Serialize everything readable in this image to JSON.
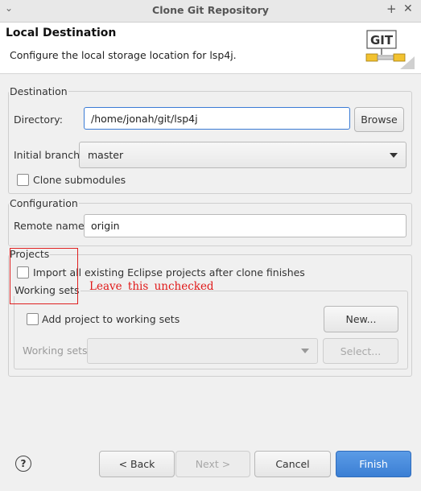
{
  "window": {
    "title": "Clone Git Repository"
  },
  "header": {
    "title": "Local Destination",
    "description": "Configure the local storage location for lsp4j.",
    "logo_text": "GIT"
  },
  "destination": {
    "group_label": "Destination",
    "directory_label": "Directory:",
    "directory_value": "/home/jonah/git/lsp4j",
    "browse_label": "Browse",
    "branch_label": "Initial branch:",
    "branch_value": "master",
    "clone_submodules_label": "Clone submodules",
    "clone_submodules_checked": false
  },
  "configuration": {
    "group_label": "Configuration",
    "remote_name_label": "Remote name:",
    "remote_name_value": "origin"
  },
  "projects": {
    "group_label": "Projects",
    "import_label": "Import all existing Eclipse projects after clone finishes",
    "import_checked": false,
    "working_sets": {
      "group_label": "Working sets",
      "add_label": "Add project to working sets",
      "add_checked": false,
      "new_label": "New...",
      "sets_label": "Working sets:",
      "sets_value": "",
      "select_label": "Select..."
    }
  },
  "annotation": {
    "text": "Leave this unchecked",
    "color": "#e01818"
  },
  "footer": {
    "help_icon": "?",
    "back_label": "< Back",
    "next_label": "Next >",
    "cancel_label": "Cancel",
    "finish_label": "Finish"
  },
  "colors": {
    "accent": "#3b7fd4",
    "focus_border": "#3a7bd5",
    "annotation": "#e02020"
  }
}
